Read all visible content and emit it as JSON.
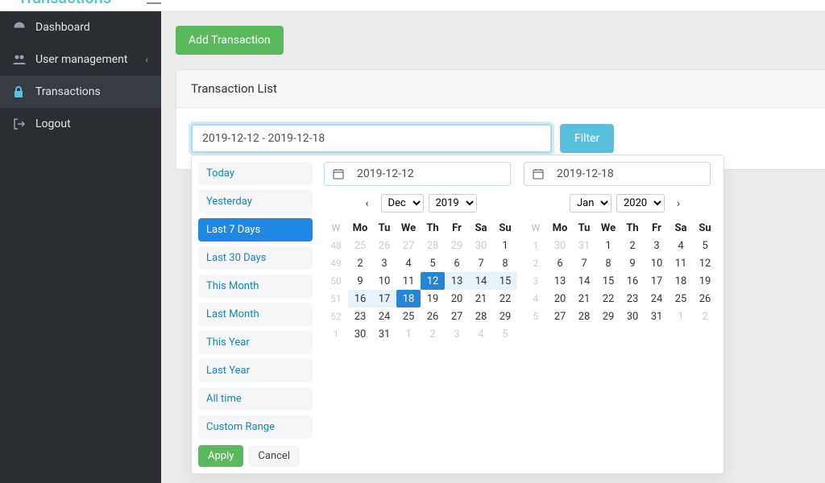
{
  "topbar": {
    "brand": "Transactions"
  },
  "sidebar": {
    "items": [
      {
        "icon": "dashboard",
        "label": "Dashboard"
      },
      {
        "icon": "users",
        "label": "User management",
        "expandable": true
      },
      {
        "icon": "lock",
        "label": "Transactions",
        "active": true
      },
      {
        "icon": "logout",
        "label": "Logout"
      }
    ]
  },
  "main": {
    "add_button": "Add Transaction",
    "card_title": "Transaction List",
    "date_range_value": "2019-12-12 - 2019-12-18",
    "filter_button": "Filter"
  },
  "picker": {
    "ranges": [
      "Today",
      "Yesterday",
      "Last 7 Days",
      "Last 30 Days",
      "This Month",
      "Last Month",
      "This Year",
      "Last Year",
      "All time",
      "Custom Range"
    ],
    "active_range_index": 2,
    "apply": "Apply",
    "cancel": "Cancel",
    "left": {
      "input": "2019-12-12",
      "month": "Dec",
      "year": "2019",
      "weeks": [
        {
          "wk": "48",
          "days": [
            {
              "n": 25,
              "off": true
            },
            {
              "n": 26,
              "off": true
            },
            {
              "n": 27,
              "off": true
            },
            {
              "n": 28,
              "off": true
            },
            {
              "n": 29,
              "off": true
            },
            {
              "n": 30,
              "off": true
            },
            {
              "n": 1
            }
          ]
        },
        {
          "wk": "49",
          "days": [
            {
              "n": 2
            },
            {
              "n": 3
            },
            {
              "n": 4
            },
            {
              "n": 5
            },
            {
              "n": 6
            },
            {
              "n": 7
            },
            {
              "n": 8
            }
          ]
        },
        {
          "wk": "50",
          "days": [
            {
              "n": 9
            },
            {
              "n": 10
            },
            {
              "n": 11
            },
            {
              "n": 12,
              "sel": true,
              "in": true
            },
            {
              "n": 13,
              "in": true
            },
            {
              "n": 14,
              "in": true
            },
            {
              "n": 15,
              "in": true
            }
          ]
        },
        {
          "wk": "51",
          "days": [
            {
              "n": 16,
              "in": true
            },
            {
              "n": 17,
              "in": true
            },
            {
              "n": 18,
              "sel": true,
              "in": true
            },
            {
              "n": 19
            },
            {
              "n": 20
            },
            {
              "n": 21
            },
            {
              "n": 22
            }
          ]
        },
        {
          "wk": "52",
          "days": [
            {
              "n": 23
            },
            {
              "n": 24
            },
            {
              "n": 25
            },
            {
              "n": 26
            },
            {
              "n": 27
            },
            {
              "n": 28
            },
            {
              "n": 29
            }
          ]
        },
        {
          "wk": "1",
          "days": [
            {
              "n": 30
            },
            {
              "n": 31
            },
            {
              "n": 1,
              "off": true
            },
            {
              "n": 2,
              "off": true
            },
            {
              "n": 3,
              "off": true
            },
            {
              "n": 4,
              "off": true
            },
            {
              "n": 5,
              "off": true
            }
          ]
        }
      ]
    },
    "right": {
      "input": "2019-12-18",
      "month": "Jan",
      "year": "2020",
      "weeks": [
        {
          "wk": "1",
          "days": [
            {
              "n": 30,
              "off": true
            },
            {
              "n": 31,
              "off": true
            },
            {
              "n": 1
            },
            {
              "n": 2
            },
            {
              "n": 3
            },
            {
              "n": 4
            },
            {
              "n": 5
            }
          ]
        },
        {
          "wk": "2",
          "days": [
            {
              "n": 6
            },
            {
              "n": 7
            },
            {
              "n": 8
            },
            {
              "n": 9
            },
            {
              "n": 10
            },
            {
              "n": 11
            },
            {
              "n": 12
            }
          ]
        },
        {
          "wk": "3",
          "days": [
            {
              "n": 13
            },
            {
              "n": 14
            },
            {
              "n": 15
            },
            {
              "n": 16
            },
            {
              "n": 17
            },
            {
              "n": 18
            },
            {
              "n": 19
            }
          ]
        },
        {
          "wk": "4",
          "days": [
            {
              "n": 20
            },
            {
              "n": 21
            },
            {
              "n": 22
            },
            {
              "n": 23
            },
            {
              "n": 24
            },
            {
              "n": 25
            },
            {
              "n": 26
            }
          ]
        },
        {
          "wk": "5",
          "days": [
            {
              "n": 27
            },
            {
              "n": 28
            },
            {
              "n": 29
            },
            {
              "n": 30
            },
            {
              "n": 31
            },
            {
              "n": 1,
              "off": true
            },
            {
              "n": 2,
              "off": true
            }
          ]
        }
      ]
    },
    "dow": [
      "Mo",
      "Tu",
      "We",
      "Th",
      "Fr",
      "Sa",
      "Su"
    ],
    "week_header": "W"
  }
}
